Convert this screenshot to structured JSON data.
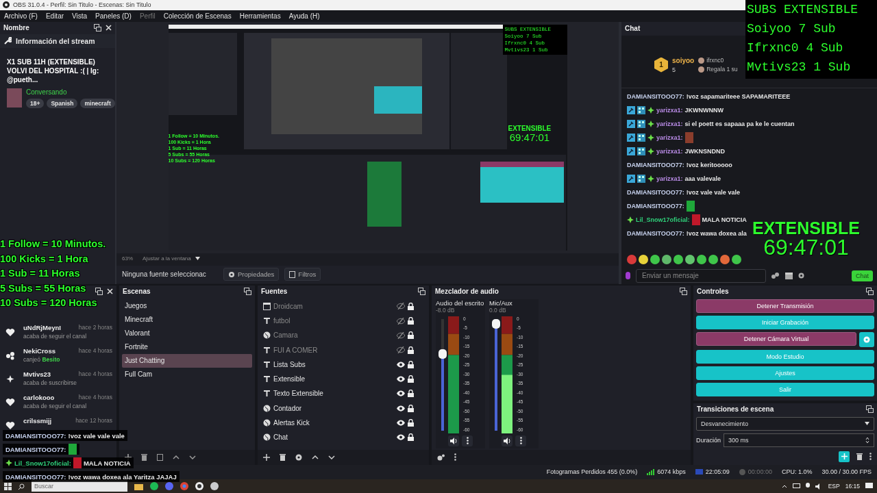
{
  "window": {
    "title": "OBS 31.0.4 - Perfil: Sin Titulo - Escenas: Sin Titulo"
  },
  "menu": [
    {
      "label": "Archivo (F)",
      "disabled": false
    },
    {
      "label": "Editar",
      "disabled": false
    },
    {
      "label": "Vista",
      "disabled": false
    },
    {
      "label": "Paneles (D)",
      "disabled": false
    },
    {
      "label": "Perfil",
      "disabled": true
    },
    {
      "label": "Colección de Escenas",
      "disabled": false
    },
    {
      "label": "Herramientas",
      "disabled": false
    },
    {
      "label": "Ayuda (H)",
      "disabled": false
    }
  ],
  "stream_info": {
    "dock_title": "Nombre",
    "heading": "Información del stream",
    "title": "X1 SUB 11H (EXTENSIBLE) VOLVI DEL HOSPITAL :( | Ig: @pueth...",
    "category": "Conversando",
    "tags": [
      "18+",
      "Spanish",
      "minecraft"
    ]
  },
  "preview": {
    "subs_title": "SUBS EXTENSIBLE",
    "subs": [
      "Soiyoo 7 Sub",
      "Ifrxnc0 4 Sub",
      "Mvtivs23 1 Sub"
    ],
    "timer_label": "EXTENSIBLE",
    "timer": "69:47:01",
    "rules": [
      "1 Follow = 10 Minutos.",
      "100 Kicks = 1 Hora",
      "1 Sub = 11 Horas",
      "5 Subs = 55 Horas",
      "10 Subs = 120 Horas"
    ],
    "zoom": "63%",
    "fit": "Ajustar a la ventana"
  },
  "source_bar": {
    "selection": "Ninguna fuente seleccionac",
    "properties": "Propiedades",
    "filters": "Filtros"
  },
  "chat": {
    "title": "Chat",
    "top_gifter": {
      "rank": "1",
      "name": "soiyoo",
      "count": "5"
    },
    "gifters": [
      "ifrxnc0",
      "Regala 1 su"
    ],
    "messages": [
      {
        "user": "DAMIANSITOOO77:",
        "text": "!voz sapamariteee SAPAMARITEEE",
        "kind": "plain",
        "color": "#c7d2ee"
      },
      {
        "user": "yarizxa1:",
        "text": "JKWNWNNW",
        "kind": "mod_sub",
        "color": "#b98be6"
      },
      {
        "user": "yarizxa1:",
        "text": "si el poett es sapaaa pa ke le cuentan",
        "kind": "mod_sub",
        "color": "#b98be6"
      },
      {
        "user": "yarizxa1:",
        "kind": "mod_sub",
        "color": "#b98be6",
        "emote": {
          "color": "#8a3d2c"
        }
      },
      {
        "user": "yarizxa1:",
        "text": "JWKNSNDND",
        "kind": "mod_sub",
        "color": "#b98be6"
      },
      {
        "user": "DAMIANSITOOO77:",
        "text": "!voz keritooooo",
        "kind": "plain",
        "color": "#c7d2ee"
      },
      {
        "user": "yarizxa1:",
        "text": "aaa valevale",
        "kind": "mod_sub",
        "color": "#b98be6"
      },
      {
        "user": "DAMIANSITOOO77:",
        "text": "!voz vale vale vale",
        "kind": "plain",
        "color": "#c7d2ee"
      },
      {
        "user": "DAMIANSITOOO77:",
        "kind": "plain",
        "color": "#c7d2ee",
        "emote": {
          "color": "#1fa83a"
        }
      },
      {
        "user": "Lil_Snow17oficial:",
        "text": "MALA NOTICIA",
        "kind": "sub",
        "color": "#2fd07a",
        "emote": {
          "color": "#c0182a"
        }
      },
      {
        "user": "DAMIANSITOOO77:",
        "text": "!voz wawa doxea ala",
        "kind": "plain",
        "color": "#c7d2ee"
      }
    ],
    "emotes": [
      {
        "color": "#d93a3a"
      },
      {
        "color": "#e8d23a"
      },
      {
        "color": "#3fc54a"
      },
      {
        "color": "#5fb86a"
      },
      {
        "color": "#3fc54a"
      },
      {
        "color": "#62c46e"
      },
      {
        "color": "#3fc54a"
      },
      {
        "color": "#3fc54a"
      },
      {
        "color": "#e2683a"
      },
      {
        "color": "#3fc54a"
      }
    ],
    "placeholder": "Enviar un mensaje",
    "send": "Chat"
  },
  "activities": {
    "items": [
      {
        "name": "uNdRjMeynI",
        "time": "hace 2 horas",
        "kind": "follow",
        "action": "acaba de seguir el canal"
      },
      {
        "name": "NekiCross",
        "time": "hace 4 horas",
        "kind": "redeem",
        "action": "canjeó",
        "reward": "Besito"
      },
      {
        "name": "Mvtivs23",
        "time": "hace 4 horas",
        "kind": "sub",
        "action": "acaba de suscribirse"
      },
      {
        "name": "carlokooo",
        "time": "hace 4 horas",
        "kind": "follow",
        "action": "acaba de seguir el canal"
      },
      {
        "name": "crilssmijj",
        "time": "hace 12 horas",
        "kind": "follow"
      }
    ]
  },
  "scenes": {
    "title": "Escenas",
    "items": [
      {
        "name": "Juegos",
        "selected": false
      },
      {
        "name": "Minecraft",
        "selected": false
      },
      {
        "name": "Valorant",
        "selected": false
      },
      {
        "name": "Fortnite",
        "selected": false
      },
      {
        "name": "Just Chatting",
        "selected": true
      },
      {
        "name": "Full Cam",
        "selected": false
      }
    ]
  },
  "sources": {
    "title": "Fuentes",
    "items": [
      {
        "name": "Droidcam",
        "kind": "window",
        "visible": false
      },
      {
        "name": "futbol",
        "kind": "text",
        "visible": false
      },
      {
        "name": "Camara",
        "kind": "browser",
        "visible": false
      },
      {
        "name": "FUI A COMER",
        "kind": "text",
        "visible": false
      },
      {
        "name": "Lista Subs",
        "kind": "text",
        "visible": true
      },
      {
        "name": "Extensible",
        "kind": "text",
        "visible": true
      },
      {
        "name": "Texto Extensible",
        "kind": "text",
        "visible": true
      },
      {
        "name": "Contador",
        "kind": "browser",
        "visible": true
      },
      {
        "name": "Alertas Kick",
        "kind": "browser",
        "visible": true
      },
      {
        "name": "Chat",
        "kind": "browser",
        "visible": true
      }
    ]
  },
  "mixer": {
    "title": "Mezclador de audio",
    "channels": [
      {
        "name": "Audio del escrito",
        "reading": "-8.0 dB",
        "level": 0.7,
        "scale": [
          "0",
          "-5",
          "-10",
          "-15",
          "-20",
          "-25",
          "-30",
          "-35",
          "-40",
          "-45",
          "-50",
          "-55",
          "-60"
        ]
      },
      {
        "name": "Mic/Aux",
        "reading": "0.0 dB",
        "level": 1.0,
        "scale": [
          "0",
          "-5",
          "-10",
          "-15",
          "-20",
          "-25",
          "-30",
          "-35",
          "-40",
          "-45",
          "-50",
          "-55",
          "-60"
        ]
      }
    ]
  },
  "controls": {
    "title": "Controles",
    "buttons": [
      {
        "label": "Detener Transmisión",
        "active": true,
        "kind": "plain"
      },
      {
        "label": "Iniciar Grabación",
        "active": false,
        "kind": "plain"
      },
      {
        "label": "Detener Cámara Virtual",
        "active": true,
        "kind": "with_settings"
      },
      {
        "label": "Modo Estudio",
        "active": false,
        "kind": "plain"
      },
      {
        "label": "Ajustes",
        "active": false,
        "kind": "plain"
      },
      {
        "label": "Salir",
        "active": false,
        "kind": "plain"
      }
    ]
  },
  "transitions": {
    "title": "Transiciones de escena",
    "selected": "Desvanecimiento",
    "duration_label": "Duración",
    "duration": "300 ms"
  },
  "status_bar": {
    "dropped": "Fotogramas Perdidos 455 (0.0%)",
    "bitrate": "6074 kbps",
    "stream_time": "22:05:09",
    "record_time": "00:00:00",
    "cpu": "CPU: 1.0%",
    "fps": "30.00 / 30.00 FPS"
  },
  "taskbar": {
    "search_placeholder": "Buscar",
    "language": "ESP",
    "clock": "16:15"
  },
  "overlays": {
    "subs_title": "SUBS EXTENSIBLE",
    "subs": [
      "Soiyoo 7 Sub",
      "Ifrxnc0 4 Sub",
      "Mvtivs23 1 Sub"
    ],
    "rules": [
      "1 Follow = 10 Minutos.",
      "100 Kicks = 1 Hora",
      "1 Sub = 11 Horas",
      "5 Subs = 55 Horas",
      "10 Subs = 120 Horas"
    ],
    "timer_label": "EXTENSIBLE",
    "timer": "69:47:01",
    "chat": [
      {
        "user": "DAMIANSITOOO77:",
        "text": "!voz vale vale vale",
        "color": "#c7d2ee",
        "kind": "plain"
      },
      {
        "user": "DAMIANSITOOO77:",
        "color": "#c7d2ee",
        "kind": "plain",
        "emote": {
          "color": "#1fa83a"
        }
      },
      {
        "user": "Lil_Snow17oficial:",
        "text": "MALA NOTICIA",
        "color": "#2fd07a",
        "kind": "sub",
        "emote": {
          "color": "#c0182a"
        }
      },
      {
        "user": "DAMIANSITOOO77:",
        "text": "!voz wawa doxea ala Yaritza JAJAJ",
        "color": "#c7d2ee",
        "kind": "plain"
      }
    ]
  }
}
